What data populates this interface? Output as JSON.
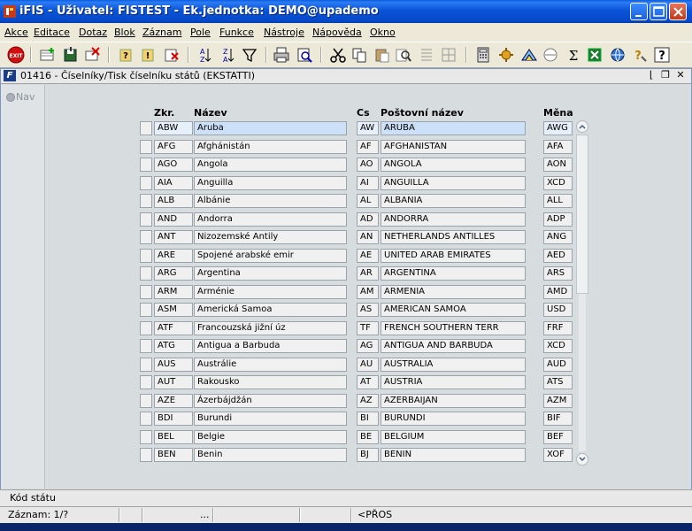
{
  "window": {
    "title": "iFIS - Uživatel: FISTEST - Ek.jednotka: DEMO@upademo"
  },
  "menu": [
    "Akce",
    "Editace",
    "Dotaz",
    "Blok",
    "Záznam",
    "Pole",
    "Funkce",
    "Nástroje",
    "Nápověda",
    "Okno"
  ],
  "form": {
    "title": "01416 - Číselníky/Tisk číselníku států (EKSTATTI)",
    "nav_label": "Nav"
  },
  "columns": {
    "zkr": "Zkr.",
    "nazev": "Název",
    "cs": "Cs",
    "postovni": "Poštovní název",
    "mena": "Měna"
  },
  "rows": [
    {
      "zkr": "ABW",
      "nazev": "Aruba",
      "cs": "AW",
      "postovni": "ARUBA",
      "mena": "AWG"
    },
    {
      "zkr": "AFG",
      "nazev": "Afghánistán",
      "cs": "AF",
      "postovni": "AFGHANISTAN",
      "mena": "AFA"
    },
    {
      "zkr": "AGO",
      "nazev": "Angola",
      "cs": "AO",
      "postovni": "ANGOLA",
      "mena": "AON"
    },
    {
      "zkr": "AIA",
      "nazev": "Anguilla",
      "cs": "AI",
      "postovni": "ANGUILLA",
      "mena": "XCD"
    },
    {
      "zkr": "ALB",
      "nazev": "Albánie",
      "cs": "AL",
      "postovni": "ALBANIA",
      "mena": "ALL"
    },
    {
      "zkr": "AND",
      "nazev": "Andorra",
      "cs": "AD",
      "postovni": "ANDORRA",
      "mena": "ADP"
    },
    {
      "zkr": "ANT",
      "nazev": "Nizozemské Antily",
      "cs": "AN",
      "postovni": "NETHERLANDS ANTILLES",
      "mena": "ANG"
    },
    {
      "zkr": "ARE",
      "nazev": "Spojené arabské emir",
      "cs": "AE",
      "postovni": "UNITED ARAB EMIRATES",
      "mena": "AED"
    },
    {
      "zkr": "ARG",
      "nazev": "Argentina",
      "cs": "AR",
      "postovni": "ARGENTINA",
      "mena": "ARS"
    },
    {
      "zkr": "ARM",
      "nazev": "Arménie",
      "cs": "AM",
      "postovni": "ARMENIA",
      "mena": "AMD"
    },
    {
      "zkr": "ASM",
      "nazev": "Americká Samoa",
      "cs": "AS",
      "postovni": "AMERICAN SAMOA",
      "mena": "USD"
    },
    {
      "zkr": "ATF",
      "nazev": "Francouzská jižní úz",
      "cs": "TF",
      "postovni": "FRENCH SOUTHERN TERR",
      "mena": "FRF"
    },
    {
      "zkr": "ATG",
      "nazev": "Antigua a Barbuda",
      "cs": "AG",
      "postovni": "ANTIGUA AND BARBUDA",
      "mena": "XCD"
    },
    {
      "zkr": "AUS",
      "nazev": "Austrálie",
      "cs": "AU",
      "postovni": "AUSTRALIA",
      "mena": "AUD"
    },
    {
      "zkr": "AUT",
      "nazev": "Rakousko",
      "cs": "AT",
      "postovni": "AUSTRIA",
      "mena": "ATS"
    },
    {
      "zkr": "AZE",
      "nazev": "Ázerbájdžán",
      "cs": "AZ",
      "postovni": "AZERBAIJAN",
      "mena": "AZM"
    },
    {
      "zkr": "BDI",
      "nazev": "Burundi",
      "cs": "BI",
      "postovni": "BURUNDI",
      "mena": "BIF"
    },
    {
      "zkr": "BEL",
      "nazev": "Belgie",
      "cs": "BE",
      "postovni": "BELGIUM",
      "mena": "BEF"
    },
    {
      "zkr": "BEN",
      "nazev": "Benin",
      "cs": "BJ",
      "postovni": "BENIN",
      "mena": "XOF"
    }
  ],
  "status": {
    "field_label": "Kód státu",
    "record": "Záznam: 1/?",
    "dots": "...",
    "mode": "<PŘOS"
  },
  "icons": [
    "exit-icon",
    "insert-record-icon",
    "save-icon",
    "delete-icon",
    "query-icon",
    "execute-query-icon",
    "clear-icon",
    "sort-asc-icon",
    "sort-desc-icon",
    "filter-icon",
    "print-icon",
    "preview-icon",
    "cut-icon",
    "copy-icon",
    "paste-icon",
    "search-icon",
    "list-icon",
    "grid-icon",
    "calculator-icon",
    "settings-icon",
    "chart-icon",
    "sum-icon",
    "excel-icon",
    "help-icon",
    "question-icon"
  ]
}
